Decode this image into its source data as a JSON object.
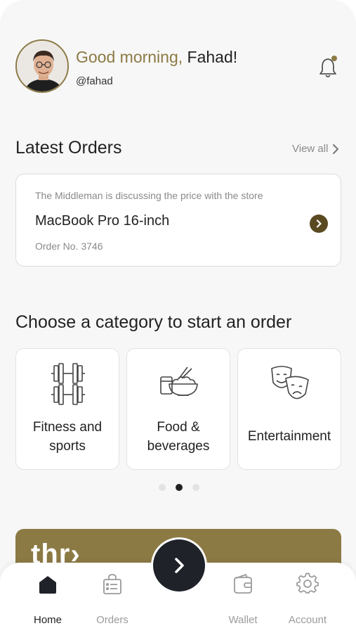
{
  "header": {
    "greeting_prefix": "Good morning, ",
    "user_name": "Fahad!",
    "handle": "@fahad",
    "avatar_icon": "user-avatar",
    "notification_icon": "bell-icon"
  },
  "latest_orders": {
    "title": "Latest Orders",
    "view_all_label": "View all",
    "order": {
      "status": "The Middleman is discussing the price with the store",
      "title": "MacBook Pro 16-inch",
      "number": "Order No. 3746"
    }
  },
  "categories": {
    "title": "Choose a category to start an order",
    "items": [
      {
        "line1": "Fitness and",
        "line2": "sports",
        "icon": "dumbbell-icon"
      },
      {
        "line1": "Food &",
        "line2": "beverages",
        "icon": "food-bowl-icon"
      },
      {
        "line1": "Entertainment",
        "line2": "",
        "icon": "theater-masks-icon"
      }
    ],
    "carousel_page": 2,
    "carousel_pages": 3
  },
  "banner": {
    "logo_text": "thr›"
  },
  "nav": {
    "items": [
      {
        "label": "Home",
        "icon": "home-icon",
        "active": true
      },
      {
        "label": "Orders",
        "icon": "orders-bag-icon",
        "active": false
      },
      {
        "label": "Wallet",
        "icon": "wallet-icon",
        "active": false
      },
      {
        "label": "Account",
        "icon": "gear-icon",
        "active": false
      }
    ],
    "center_action_icon": "chevron-right-icon"
  },
  "colors": {
    "accent": "#8c7a45",
    "dark": "#1f2228",
    "muted": "#8a8a8a",
    "background": "#f7f7f7"
  }
}
